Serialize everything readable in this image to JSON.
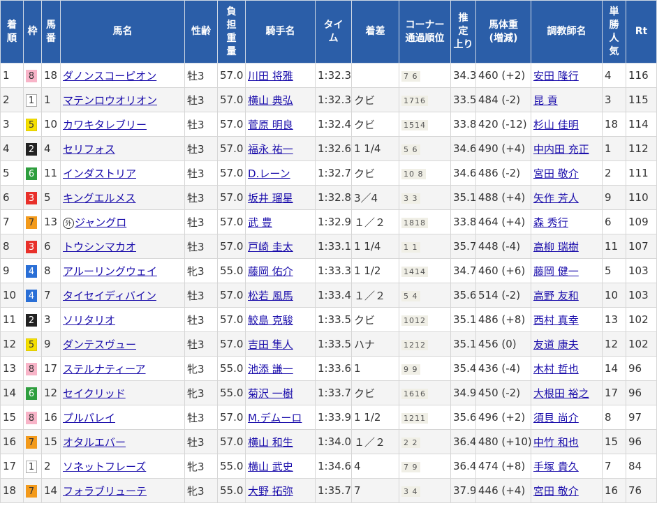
{
  "headers": [
    "着順",
    "枠",
    "馬番",
    "馬名",
    "性齢",
    "負担重量",
    "騎手名",
    "タイム",
    "着差",
    "コーナー通過順位",
    "推定上り",
    "馬体重(増減)",
    "調教師名",
    "単勝人気",
    "Rt"
  ],
  "waku_colors": {
    "1": {
      "bg": "#ffffff",
      "fg": "#333333",
      "border": "#aaaaaa"
    },
    "2": {
      "bg": "#222222",
      "fg": "#ffffff",
      "border": "#222222"
    },
    "3": {
      "bg": "#e8302a",
      "fg": "#ffffff",
      "border": "#e8302a"
    },
    "4": {
      "bg": "#2a6fd6",
      "fg": "#ffffff",
      "border": "#2a6fd6"
    },
    "5": {
      "bg": "#f5e000",
      "fg": "#333333",
      "border": "#e0cc00"
    },
    "6": {
      "bg": "#2e9e3e",
      "fg": "#ffffff",
      "border": "#2e9e3e"
    },
    "7": {
      "bg": "#f39a1b",
      "fg": "#333333",
      "border": "#f39a1b"
    },
    "8": {
      "bg": "#f8b4c8",
      "fg": "#333333",
      "border": "#f8b4c8"
    }
  },
  "rows": [
    {
      "rank": "1",
      "waku": "8",
      "num": "18",
      "badge": "",
      "horse": "ダノンスコーピオン",
      "sex_age": "牡3",
      "weight": "57.0",
      "jockey": "川田 将雅",
      "time": "1:32.3",
      "margin": "",
      "corner": "7 6",
      "last3f": "34.3",
      "body_weight": "460 (+2)",
      "trainer": "安田 隆行",
      "pop": "4",
      "rt": "116"
    },
    {
      "rank": "2",
      "waku": "1",
      "num": "1",
      "badge": "",
      "horse": "マテンロウオリオン",
      "sex_age": "牡3",
      "weight": "57.0",
      "jockey": "横山 典弘",
      "time": "1:32.3",
      "margin": "クビ",
      "corner": "1716",
      "last3f": "33.5",
      "body_weight": "484 (-2)",
      "trainer": "昆 貢",
      "pop": "3",
      "rt": "115"
    },
    {
      "rank": "3",
      "waku": "5",
      "num": "10",
      "badge": "",
      "horse": "カワキタレブリー",
      "sex_age": "牡3",
      "weight": "57.0",
      "jockey": "菅原 明良",
      "time": "1:32.4",
      "margin": "クビ",
      "corner": "1514",
      "last3f": "33.8",
      "body_weight": "420 (-12)",
      "trainer": "杉山 佳明",
      "pop": "18",
      "rt": "114"
    },
    {
      "rank": "4",
      "waku": "2",
      "num": "4",
      "badge": "",
      "horse": "セリフォス",
      "sex_age": "牡3",
      "weight": "57.0",
      "jockey": "福永 祐一",
      "time": "1:32.6",
      "margin": "1 1/4",
      "corner": "5 6",
      "last3f": "34.6",
      "body_weight": "490 (+4)",
      "trainer": "中内田 充正",
      "pop": "1",
      "rt": "112"
    },
    {
      "rank": "5",
      "waku": "6",
      "num": "11",
      "badge": "",
      "horse": "インダストリア",
      "sex_age": "牡3",
      "weight": "57.0",
      "jockey": "D.レーン",
      "time": "1:32.7",
      "margin": "クビ",
      "corner": "10 8",
      "last3f": "34.6",
      "body_weight": "486 (-2)",
      "trainer": "宮田 敬介",
      "pop": "2",
      "rt": "111"
    },
    {
      "rank": "6",
      "waku": "3",
      "num": "5",
      "badge": "",
      "horse": "キングエルメス",
      "sex_age": "牡3",
      "weight": "57.0",
      "jockey": "坂井 瑠星",
      "time": "1:32.8",
      "margin": "3／4",
      "corner": "3 3",
      "last3f": "35.1",
      "body_weight": "488 (+4)",
      "trainer": "矢作 芳人",
      "pop": "9",
      "rt": "110"
    },
    {
      "rank": "7",
      "waku": "7",
      "num": "13",
      "badge": "外",
      "horse": "ジャングロ",
      "sex_age": "牡3",
      "weight": "57.0",
      "jockey": "武 豊",
      "time": "1:32.9",
      "margin": "１／２",
      "corner": "1818",
      "last3f": "33.8",
      "body_weight": "464 (+4)",
      "trainer": "森 秀行",
      "pop": "6",
      "rt": "109"
    },
    {
      "rank": "8",
      "waku": "3",
      "num": "6",
      "badge": "",
      "horse": "トウシンマカオ",
      "sex_age": "牡3",
      "weight": "57.0",
      "jockey": "戸崎 圭太",
      "time": "1:33.1",
      "margin": "1 1/4",
      "corner": "1 1",
      "last3f": "35.7",
      "body_weight": "448 (-4)",
      "trainer": "高柳 瑞樹",
      "pop": "11",
      "rt": "107"
    },
    {
      "rank": "9",
      "waku": "4",
      "num": "8",
      "badge": "",
      "horse": "アルーリングウェイ",
      "sex_age": "牝3",
      "weight": "55.0",
      "jockey": "藤岡 佑介",
      "time": "1:33.3",
      "margin": "1 1/2",
      "corner": "1414",
      "last3f": "34.7",
      "body_weight": "460 (+6)",
      "trainer": "藤岡 健一",
      "pop": "5",
      "rt": "103"
    },
    {
      "rank": "10",
      "waku": "4",
      "num": "7",
      "badge": "",
      "horse": "タイセイディバイン",
      "sex_age": "牡3",
      "weight": "57.0",
      "jockey": "松若 風馬",
      "time": "1:33.4",
      "margin": "１／２",
      "corner": "5 4",
      "last3f": "35.6",
      "body_weight": "514 (-2)",
      "trainer": "高野 友和",
      "pop": "10",
      "rt": "103"
    },
    {
      "rank": "11",
      "waku": "2",
      "num": "3",
      "badge": "",
      "horse": "ソリタリオ",
      "sex_age": "牡3",
      "weight": "57.0",
      "jockey": "鮫島 克駿",
      "time": "1:33.5",
      "margin": "クビ",
      "corner": "1012",
      "last3f": "35.1",
      "body_weight": "486 (+8)",
      "trainer": "西村 真幸",
      "pop": "13",
      "rt": "102"
    },
    {
      "rank": "12",
      "waku": "5",
      "num": "9",
      "badge": "",
      "horse": "ダンテスヴュー",
      "sex_age": "牡3",
      "weight": "57.0",
      "jockey": "吉田 隼人",
      "time": "1:33.5",
      "margin": "ハナ",
      "corner": "1212",
      "last3f": "35.1",
      "body_weight": "456 (0)",
      "trainer": "友道 康夫",
      "pop": "12",
      "rt": "102"
    },
    {
      "rank": "13",
      "waku": "8",
      "num": "17",
      "badge": "",
      "horse": "ステルナティーア",
      "sex_age": "牝3",
      "weight": "55.0",
      "jockey": "池添 謙一",
      "time": "1:33.6",
      "margin": "1",
      "corner": "9 9",
      "last3f": "35.4",
      "body_weight": "436 (-4)",
      "trainer": "木村 哲也",
      "pop": "14",
      "rt": "96"
    },
    {
      "rank": "14",
      "waku": "6",
      "num": "12",
      "badge": "",
      "horse": "セイクリッド",
      "sex_age": "牝3",
      "weight": "55.0",
      "jockey": "菊沢 一樹",
      "time": "1:33.7",
      "margin": "クビ",
      "corner": "1616",
      "last3f": "34.9",
      "body_weight": "450 (-2)",
      "trainer": "大根田 裕之",
      "pop": "17",
      "rt": "96"
    },
    {
      "rank": "15",
      "waku": "8",
      "num": "16",
      "badge": "",
      "horse": "プルパレイ",
      "sex_age": "牡3",
      "weight": "57.0",
      "jockey": "M.デムーロ",
      "time": "1:33.9",
      "margin": "1 1/2",
      "corner": "1211",
      "last3f": "35.6",
      "body_weight": "496 (+2)",
      "trainer": "須貝 尚介",
      "pop": "8",
      "rt": "97"
    },
    {
      "rank": "16",
      "waku": "7",
      "num": "15",
      "badge": "",
      "horse": "オタルエバー",
      "sex_age": "牡3",
      "weight": "57.0",
      "jockey": "横山 和生",
      "time": "1:34.0",
      "margin": "１／２",
      "corner": "2 2",
      "last3f": "36.4",
      "body_weight": "480 (+10)",
      "trainer": "中竹 和也",
      "pop": "15",
      "rt": "96"
    },
    {
      "rank": "17",
      "waku": "1",
      "num": "2",
      "badge": "",
      "horse": "ソネットフレーズ",
      "sex_age": "牝3",
      "weight": "55.0",
      "jockey": "横山 武史",
      "time": "1:34.6",
      "margin": "4",
      "corner": "7 9",
      "last3f": "36.4",
      "body_weight": "474 (+8)",
      "trainer": "手塚 貴久",
      "pop": "7",
      "rt": "84"
    },
    {
      "rank": "18",
      "waku": "7",
      "num": "14",
      "badge": "",
      "horse": "フォラブリューテ",
      "sex_age": "牝3",
      "weight": "55.0",
      "jockey": "大野 拓弥",
      "time": "1:35.7",
      "margin": "7",
      "corner": "3 4",
      "last3f": "37.9",
      "body_weight": "446 (+4)",
      "trainer": "宮田 敬介",
      "pop": "16",
      "rt": "76"
    }
  ]
}
